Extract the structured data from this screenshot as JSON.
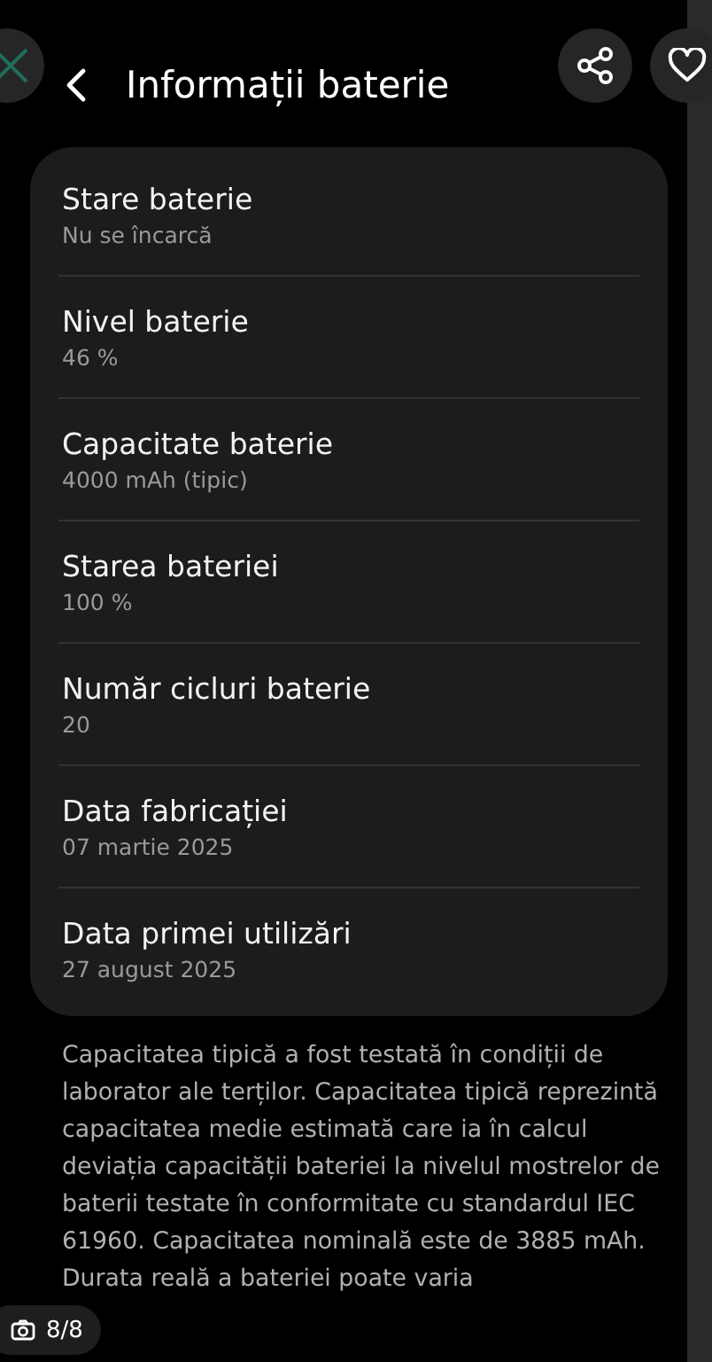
{
  "header": {
    "title": "Informații baterie"
  },
  "items": [
    {
      "label": "Stare baterie",
      "value": "Nu se încarcă"
    },
    {
      "label": "Nivel baterie",
      "value": "46 %"
    },
    {
      "label": "Capacitate baterie",
      "value": "4000 mAh (tipic)"
    },
    {
      "label": "Starea bateriei",
      "value": "100 %"
    },
    {
      "label": "Număr cicluri baterie",
      "value": "20"
    },
    {
      "label": "Data fabricației",
      "value": "07 martie 2025"
    },
    {
      "label": "Data primei utilizări",
      "value": "27 august 2025"
    }
  ],
  "note": "Capacitatea tipică a fost testată în condiții de laborator ale terților. Capacitatea tipică reprezintă capacitatea medie estimată care ia în calcul deviația capacității bateriei la nivelul mostrelor de baterii testate în conformitate cu standardul IEC 61960. Capacitatea nominală este de 3885 mAh. Durata reală a bateriei poate varia",
  "viewer": {
    "counter": "8/8"
  }
}
